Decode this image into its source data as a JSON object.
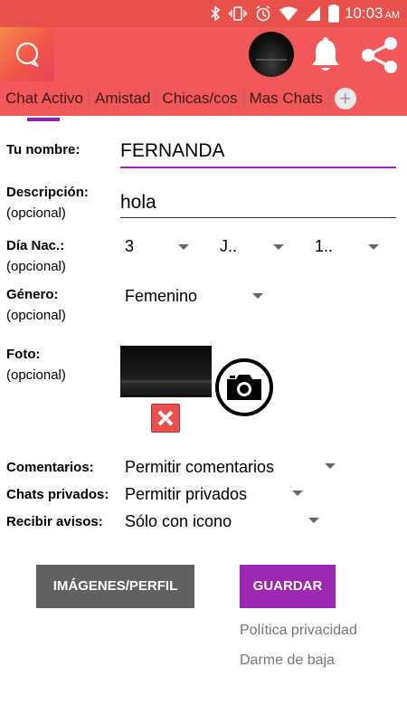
{
  "status_bar": {
    "time": "10:03",
    "ampm": "AM",
    "battery": "98"
  },
  "tabs": [
    "Chat Activo",
    "Amistad",
    "Chicas/cos",
    "Mas Chats"
  ],
  "form": {
    "name_label": "Tu nombre:",
    "name_value": "FERNANDA",
    "desc_label": "Descripción:",
    "optional": "(opcional)",
    "desc_value": "hola",
    "birth_label": "Día Nac.:",
    "birth_day": "3",
    "birth_month": "J..",
    "birth_year": "1..",
    "gender_label": "Género:",
    "gender_value": "Femenino",
    "photo_label": "Foto:",
    "comments_label": "Comentarios:",
    "comments_value": "Permitir comentarios",
    "private_label": "Chats privados:",
    "private_value": "Permitir privados",
    "notify_label": "Recibir avisos:",
    "notify_value": "Sólo con icono"
  },
  "buttons": {
    "images": "IMÁGENES/PERFIL",
    "save": "GUARDAR"
  },
  "links": {
    "privacy": "Política privacidad",
    "unsubscribe": "Darme de baja"
  },
  "colors": {
    "appbar": "#f2575a",
    "accent": "#9c27b0",
    "statusbar": "#e8504c"
  }
}
